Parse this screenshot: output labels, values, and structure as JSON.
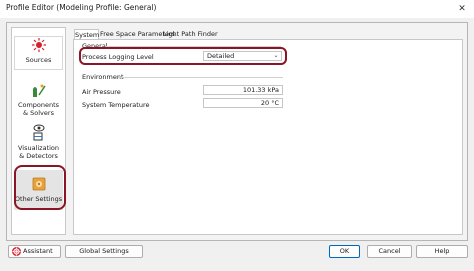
{
  "window": {
    "title": "Profile Editor (Modeling Profile: General)",
    "close_glyph": "✕"
  },
  "sidebar": {
    "items": [
      {
        "label": "Sources",
        "icon": "sources-icon"
      },
      {
        "label": "Components\n& Solvers",
        "icon": "components-icon"
      },
      {
        "label": "Visualization\n& Detectors",
        "icon": "visualization-icon"
      },
      {
        "label": "Other Settings",
        "icon": "other-settings-icon",
        "selected": true
      }
    ]
  },
  "tabs": [
    {
      "label": "System",
      "active": true
    },
    {
      "label": "Free Space Parameters"
    },
    {
      "label": "Light Path Finder"
    }
  ],
  "general": {
    "title": "General",
    "process_logging_level": {
      "label": "Process Logging Level",
      "value": "Detailed"
    }
  },
  "environment": {
    "title": "Environment",
    "air_pressure": {
      "label": "Air Pressure",
      "value": "101.33 kPa"
    },
    "system_temperature": {
      "label": "System Temperature",
      "value": "20 °C"
    }
  },
  "buttons": {
    "assistant": "Assistant",
    "global_settings": "Global Settings",
    "ok": "OK",
    "cancel": "Cancel",
    "help": "Help"
  },
  "colors": {
    "highlight": "#8a1526",
    "ok_border": "#0067c0"
  }
}
